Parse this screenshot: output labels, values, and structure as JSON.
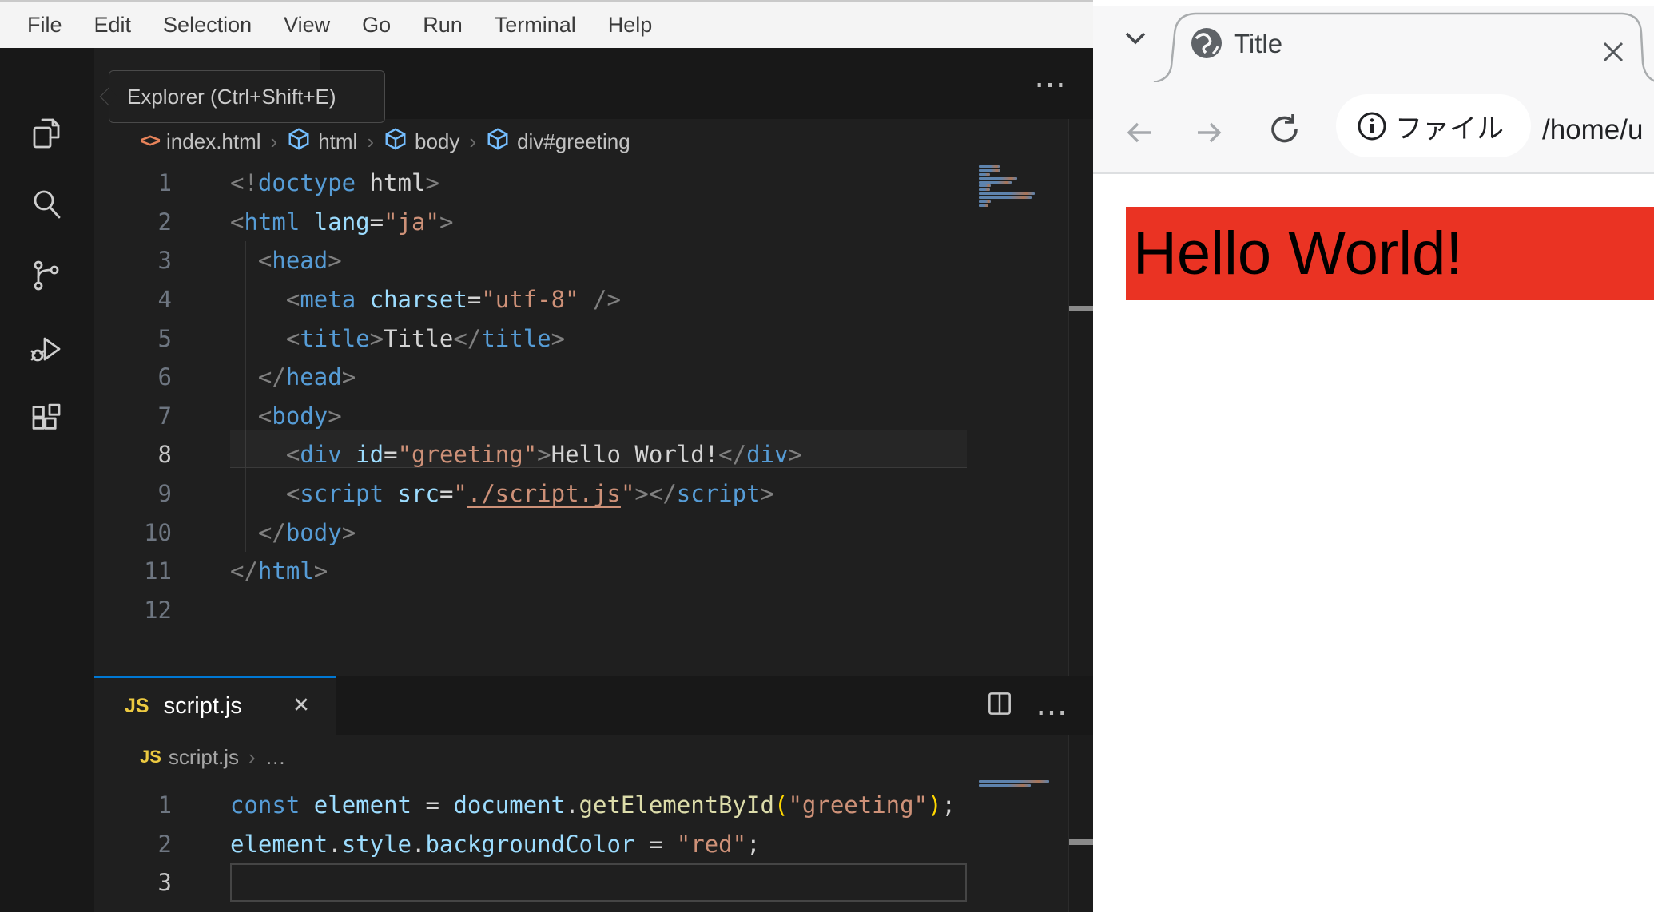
{
  "vscode": {
    "menu_bar": {
      "items": [
        "File",
        "Edit",
        "Selection",
        "View",
        "Go",
        "Run",
        "Terminal",
        "Help"
      ]
    },
    "activity_bar": {
      "tooltip": "Explorer (Ctrl+Shift+E)"
    },
    "token_colors": {
      "punct": "#808080",
      "tag": "#569cd6",
      "attr": "#9cdcfe",
      "str": "#ce9178",
      "text": "#d4d4d4",
      "kw": "#569cd6",
      "var": "#9cdcfe",
      "fn": "#dcdcaa",
      "paren": "#ffd700",
      "link": "#ce9178"
    },
    "accent_color": "#0078d4",
    "html_editor": {
      "breadcrumb": {
        "file": "index.html",
        "segments": [
          "html",
          "body",
          "div#greeting"
        ]
      },
      "active_line": 8,
      "lines": [
        [
          {
            "t": "<!",
            "c": "punct"
          },
          {
            "t": "doctype",
            "c": "tag"
          },
          {
            "t": " html",
            "c": "text"
          },
          {
            "t": ">",
            "c": "punct"
          }
        ],
        [
          {
            "t": "<",
            "c": "punct"
          },
          {
            "t": "html",
            "c": "tag"
          },
          {
            "t": " ",
            "c": "text"
          },
          {
            "t": "lang",
            "c": "attr"
          },
          {
            "t": "=",
            "c": "text"
          },
          {
            "t": "\"ja\"",
            "c": "str"
          },
          {
            "t": ">",
            "c": "punct"
          }
        ],
        [
          {
            "t": "  ",
            "c": "text"
          },
          {
            "t": "<",
            "c": "punct"
          },
          {
            "t": "head",
            "c": "tag"
          },
          {
            "t": ">",
            "c": "punct"
          }
        ],
        [
          {
            "t": "    ",
            "c": "text"
          },
          {
            "t": "<",
            "c": "punct"
          },
          {
            "t": "meta",
            "c": "tag"
          },
          {
            "t": " ",
            "c": "text"
          },
          {
            "t": "charset",
            "c": "attr"
          },
          {
            "t": "=",
            "c": "text"
          },
          {
            "t": "\"utf-8\"",
            "c": "str"
          },
          {
            "t": " ",
            "c": "text"
          },
          {
            "t": "/>",
            "c": "punct"
          }
        ],
        [
          {
            "t": "    ",
            "c": "text"
          },
          {
            "t": "<",
            "c": "punct"
          },
          {
            "t": "title",
            "c": "tag"
          },
          {
            "t": ">",
            "c": "punct"
          },
          {
            "t": "Title",
            "c": "text"
          },
          {
            "t": "</",
            "c": "punct"
          },
          {
            "t": "title",
            "c": "tag"
          },
          {
            "t": ">",
            "c": "punct"
          }
        ],
        [
          {
            "t": "  ",
            "c": "text"
          },
          {
            "t": "</",
            "c": "punct"
          },
          {
            "t": "head",
            "c": "tag"
          },
          {
            "t": ">",
            "c": "punct"
          }
        ],
        [
          {
            "t": "  ",
            "c": "text"
          },
          {
            "t": "<",
            "c": "punct"
          },
          {
            "t": "body",
            "c": "tag"
          },
          {
            "t": ">",
            "c": "punct"
          }
        ],
        [
          {
            "t": "    ",
            "c": "text"
          },
          {
            "t": "<",
            "c": "punct"
          },
          {
            "t": "div",
            "c": "tag"
          },
          {
            "t": " ",
            "c": "text"
          },
          {
            "t": "id",
            "c": "attr"
          },
          {
            "t": "=",
            "c": "text"
          },
          {
            "t": "\"greeting\"",
            "c": "str"
          },
          {
            "t": ">",
            "c": "punct"
          },
          {
            "t": "Hello World!",
            "c": "text"
          },
          {
            "t": "</",
            "c": "punct"
          },
          {
            "t": "div",
            "c": "tag"
          },
          {
            "t": ">",
            "c": "punct"
          }
        ],
        [
          {
            "t": "    ",
            "c": "text"
          },
          {
            "t": "<",
            "c": "punct"
          },
          {
            "t": "script",
            "c": "tag"
          },
          {
            "t": " ",
            "c": "text"
          },
          {
            "t": "src",
            "c": "attr"
          },
          {
            "t": "=",
            "c": "text"
          },
          {
            "t": "\"",
            "c": "str"
          },
          {
            "t": "./script.js",
            "c": "link"
          },
          {
            "t": "\"",
            "c": "str"
          },
          {
            "t": ">",
            "c": "punct"
          },
          {
            "t": "</",
            "c": "punct"
          },
          {
            "t": "script",
            "c": "tag"
          },
          {
            "t": ">",
            "c": "punct"
          }
        ],
        [
          {
            "t": "  ",
            "c": "text"
          },
          {
            "t": "</",
            "c": "punct"
          },
          {
            "t": "body",
            "c": "tag"
          },
          {
            "t": ">",
            "c": "punct"
          }
        ],
        [
          {
            "t": "</",
            "c": "punct"
          },
          {
            "t": "html",
            "c": "tag"
          },
          {
            "t": ">",
            "c": "punct"
          }
        ],
        []
      ]
    },
    "js_editor": {
      "tab": {
        "icon_text": "JS",
        "label": "script.js"
      },
      "breadcrumb": {
        "file": "script.js",
        "more": "…"
      },
      "active_line": 3,
      "lines": [
        [
          {
            "t": "const",
            "c": "kw"
          },
          {
            "t": " ",
            "c": "text"
          },
          {
            "t": "element",
            "c": "var"
          },
          {
            "t": " = ",
            "c": "text"
          },
          {
            "t": "document",
            "c": "var"
          },
          {
            "t": ".",
            "c": "text"
          },
          {
            "t": "getElementById",
            "c": "fn"
          },
          {
            "t": "(",
            "c": "paren"
          },
          {
            "t": "\"greeting\"",
            "c": "str"
          },
          {
            "t": ")",
            "c": "paren"
          },
          {
            "t": ";",
            "c": "text"
          }
        ],
        [
          {
            "t": "element",
            "c": "var"
          },
          {
            "t": ".",
            "c": "text"
          },
          {
            "t": "style",
            "c": "var"
          },
          {
            "t": ".",
            "c": "text"
          },
          {
            "t": "backgroundColor",
            "c": "var"
          },
          {
            "t": " = ",
            "c": "text"
          },
          {
            "t": "\"red\"",
            "c": "str"
          },
          {
            "t": ";",
            "c": "text"
          }
        ],
        []
      ]
    }
  },
  "browser": {
    "tab": {
      "title": "Title"
    },
    "toolbar": {
      "page_chip_label": "ファイル",
      "url": "/home/u"
    },
    "page": {
      "greeting_text": "Hello World!",
      "greeting_bg": "#ea3323"
    }
  }
}
